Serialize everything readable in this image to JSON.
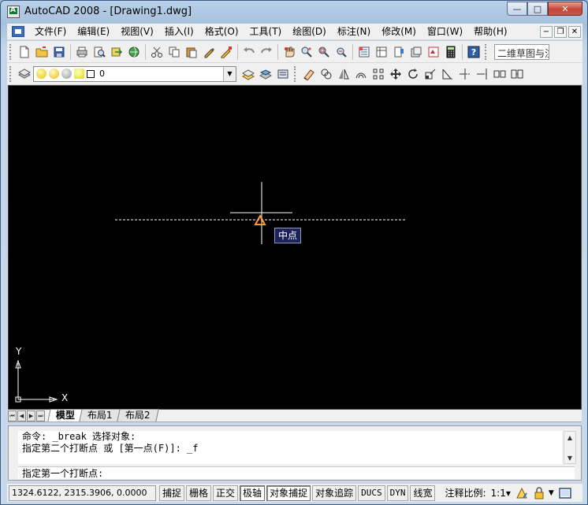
{
  "window": {
    "title": "AutoCAD 2008 - [Drawing1.dwg]",
    "caption_buttons": {
      "minimize": "—",
      "maximize": "□",
      "close": "✕"
    }
  },
  "menubar": {
    "items": [
      "文件(F)",
      "编辑(E)",
      "视图(V)",
      "插入(I)",
      "格式(O)",
      "工具(T)",
      "绘图(D)",
      "标注(N)",
      "修改(M)",
      "窗口(W)",
      "帮助(H)"
    ],
    "mdi_buttons": {
      "minimize": "−",
      "restore": "❐",
      "close": "✕"
    }
  },
  "toolbar": {
    "workspace_name": "二维草图与注释",
    "icons_row1": [
      "new-icon",
      "open-icon",
      "save-icon",
      "print-icon",
      "print-preview-icon",
      "publish-icon",
      "3d-dwf-icon",
      "cut-icon",
      "copy-icon",
      "paste-icon",
      "match-properties-icon",
      "block-editor-icon",
      "undo-icon",
      "redo-icon",
      "pan-icon",
      "zoom-realtime-icon",
      "zoom-window-icon",
      "zoom-previous-icon",
      "properties-icon",
      "design-center-icon",
      "tool-palettes-icon",
      "sheet-set-icon",
      "markup-icon",
      "quickcalc-icon",
      "help-icon"
    ],
    "layer": {
      "name": "0"
    },
    "icons_row2": [
      "layer-manager-icon",
      "make-current-icon",
      "layer-previous-icon",
      "erase-icon",
      "copy-object-icon",
      "mirror-icon",
      "offset-icon",
      "array-icon",
      "move-icon",
      "rotate-icon",
      "scale-icon",
      "stretch-icon",
      "trim-icon",
      "extend-icon",
      "break-at-point-icon",
      "break-icon",
      "join-icon"
    ]
  },
  "canvas": {
    "tooltip": "中点",
    "ucs": {
      "x": "X",
      "y": "Y"
    },
    "colors": {
      "background": "#000000",
      "crosshair": "#ffffff",
      "marker": "#ff9933"
    }
  },
  "layout_tabs": {
    "nav": [
      "⏮",
      "◀",
      "▶",
      "⏭"
    ],
    "tabs": [
      {
        "label": "模型",
        "active": true
      },
      {
        "label": "布局1",
        "active": false
      },
      {
        "label": "布局2",
        "active": false
      }
    ]
  },
  "command": {
    "history": [
      "命令: _break 选择对象:",
      "指定第二个打断点 或 [第一点(F)]: _f"
    ],
    "prompt": "指定第一个打断点:"
  },
  "statusbar": {
    "coordinates": "1324.6122, 2315.3906, 0.0000",
    "toggles": [
      {
        "label": "捕捉",
        "on": false
      },
      {
        "label": "栅格",
        "on": false
      },
      {
        "label": "正交",
        "on": false
      },
      {
        "label": "极轴",
        "on": true
      },
      {
        "label": "对象捕捉",
        "on": true
      },
      {
        "label": "对象追踪",
        "on": false
      },
      {
        "label": "DUCS",
        "on": false,
        "mono": true
      },
      {
        "label": "DYN",
        "on": false,
        "mono": true
      },
      {
        "label": "线宽",
        "on": false
      }
    ],
    "scale_label": "注释比例:",
    "scale_value": "1:1▾"
  }
}
